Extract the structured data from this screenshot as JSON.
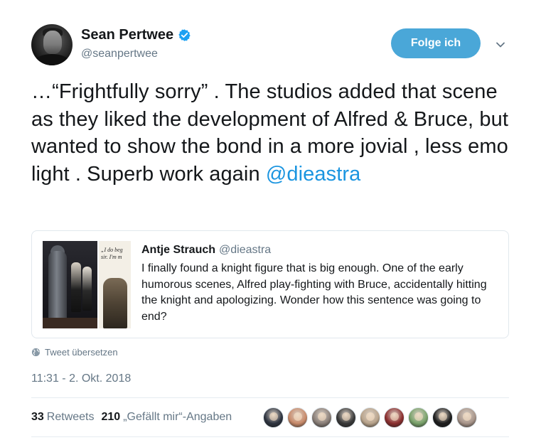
{
  "author": {
    "display_name": "Sean Pertwee",
    "handle": "@seanpertwee",
    "verified": true,
    "avatar_icon": "person-portrait-icon"
  },
  "follow_button": {
    "label": "Folge ich",
    "color": "#4aa7d8"
  },
  "menu_caret_icon": "chevron-down-icon",
  "tweet": {
    "text_parts": [
      "…“Frightfully sorry” . The studios added that scene as they liked the development of Alfred & Bruce, but wanted to show the bond in a more jovial , less emo light . Superb work again ",
      "@dieastra"
    ],
    "mention_color": "#1b95e0"
  },
  "quoted_tweet": {
    "display_name": "Antje Strauch",
    "handle": "@dieastra",
    "text": "I finally found a knight figure that is big enough. One of the early humorous scenes, Alfred play-fighting with Bruce, accidentally hitting the knight and apologizing. Wonder how this sentence was going to end?",
    "media_caption": "„I do beg\nsir. I'm m"
  },
  "translate": {
    "label": "Tweet übersetzen",
    "icon": "globe-icon"
  },
  "timestamp": "11:31 - 2. Okt. 2018",
  "stats": {
    "retweets_count": "33",
    "retweets_label": "Retweets",
    "likes_count": "210",
    "likes_label": "„Gefällt mir“-Angaben"
  },
  "liker_avatars": [
    {
      "name": "liker-1",
      "color": "#2e3440"
    },
    {
      "name": "liker-2",
      "color": "#c98b6b"
    },
    {
      "name": "liker-3",
      "color": "#8a7f78"
    },
    {
      "name": "liker-4",
      "color": "#3a3a3a"
    },
    {
      "name": "liker-5",
      "color": "#b9a48c"
    },
    {
      "name": "liker-6",
      "color": "#8c2f2f"
    },
    {
      "name": "liker-7",
      "color": "#7aa36b"
    },
    {
      "name": "liker-8",
      "color": "#1d1d1d"
    },
    {
      "name": "liker-9",
      "color": "#a8958a"
    }
  ],
  "colors": {
    "text_primary": "#14171a",
    "text_secondary": "#657786",
    "border": "#e1e8ed",
    "verified_badge": "#1da1f2"
  }
}
